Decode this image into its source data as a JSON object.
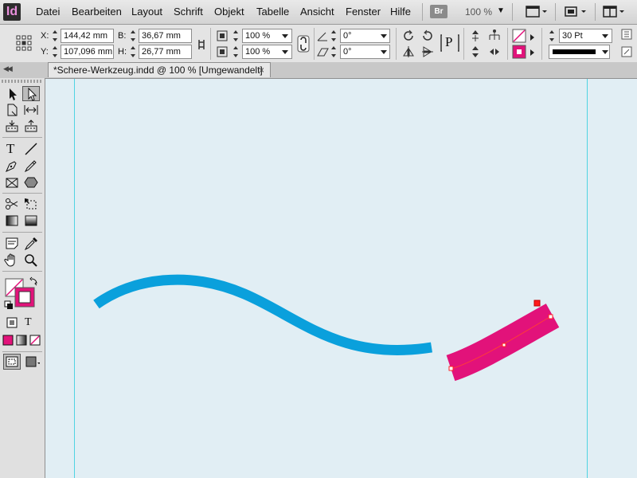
{
  "app": {
    "logo_text": "Id",
    "bridge_badge": "Br",
    "zoom_level": "100 %"
  },
  "menu": {
    "items": [
      "Datei",
      "Bearbeiten",
      "Layout",
      "Schrift",
      "Objekt",
      "Tabelle",
      "Ansicht",
      "Fenster",
      "Hilfe"
    ]
  },
  "control_panel": {
    "x_label": "X:",
    "x_value": "144,42 mm",
    "y_label": "Y:",
    "y_value": "107,096 mm",
    "w_label": "B:",
    "w_value": "36,67 mm",
    "h_label": "H:",
    "h_value": "26,77 mm",
    "scale_x": "100 %",
    "scale_y": "100 %",
    "rotation": "0°",
    "shear": "0°",
    "stroke_weight": "30 Pt",
    "text_wrap_glyph": "P"
  },
  "document_tab": {
    "title": "*Schere-Werkzeug.indd @ 100 % [Umgewandelt]",
    "close_glyph": "×"
  },
  "tools": {
    "type_glyph": "T",
    "format_text_glyph": "T"
  },
  "colors": {
    "accent_magenta": "#e2127a",
    "path_blue": "#0aa0dc",
    "guide_cyan": "#4fd4e2",
    "canvas_bg": "#e1eef4"
  }
}
